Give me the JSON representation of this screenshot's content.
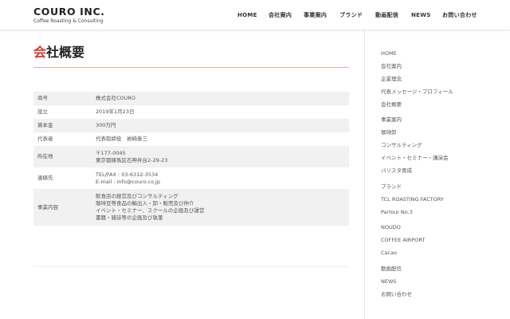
{
  "header": {
    "logo_title": "COURO INC.",
    "logo_subtitle": "Coffee Roasting & Consulting",
    "nav": [
      "HOME",
      "会社案内",
      "事業案内",
      "ブランド",
      "動画配信",
      "NEWS",
      "お問い合わせ"
    ]
  },
  "main": {
    "title_accent": "会",
    "title_rest": "社概要",
    "rows": [
      {
        "label": "商号",
        "lines": [
          "株式会社COURO"
        ]
      },
      {
        "label": "設立",
        "lines": [
          "2019年1月23日"
        ]
      },
      {
        "label": "資本金",
        "lines": [
          "300万円"
        ]
      },
      {
        "label": "代表者",
        "lines": [
          "代表取締役　岩崎泰三"
        ]
      },
      {
        "label": "所在地",
        "lines": [
          "〒177-0045",
          "東京都練馬区石神井台2-29-23"
        ]
      },
      {
        "label": "連絡先",
        "lines": [
          "TEL/FAX : 03-6312-3534",
          "E-mail : info@couro.co.jp"
        ]
      },
      {
        "label": "事業内容",
        "lines": [
          "飲食店の経営及びコンサルティング",
          "珈琲豆等食品の輸出入・卸・販売及び仲介",
          "イベント・セミナー、スクールの企画及び運営",
          "書籍・雑誌等の企画及び執筆"
        ]
      }
    ]
  },
  "sidebar": {
    "items": [
      "HOME",
      "会社案内",
      "企業理念",
      "代表メッセージ・プロフィール",
      "会社概要",
      "事業案内",
      "珈琲卸",
      "コンサルティング",
      "イベント・セミナー・講演会",
      "バリスタ育成",
      "ブランド",
      "TCL ROASTING FACTORY",
      "Parlour No.3",
      "NOUDO",
      "COFFEE AIRPORT",
      "Cacao",
      "動画配信",
      "NEWS",
      "お問い合わせ"
    ]
  },
  "colors": {
    "accent": "#d33a32",
    "rule": "#e9a8a0",
    "row_shade": "#f1f1f1"
  }
}
